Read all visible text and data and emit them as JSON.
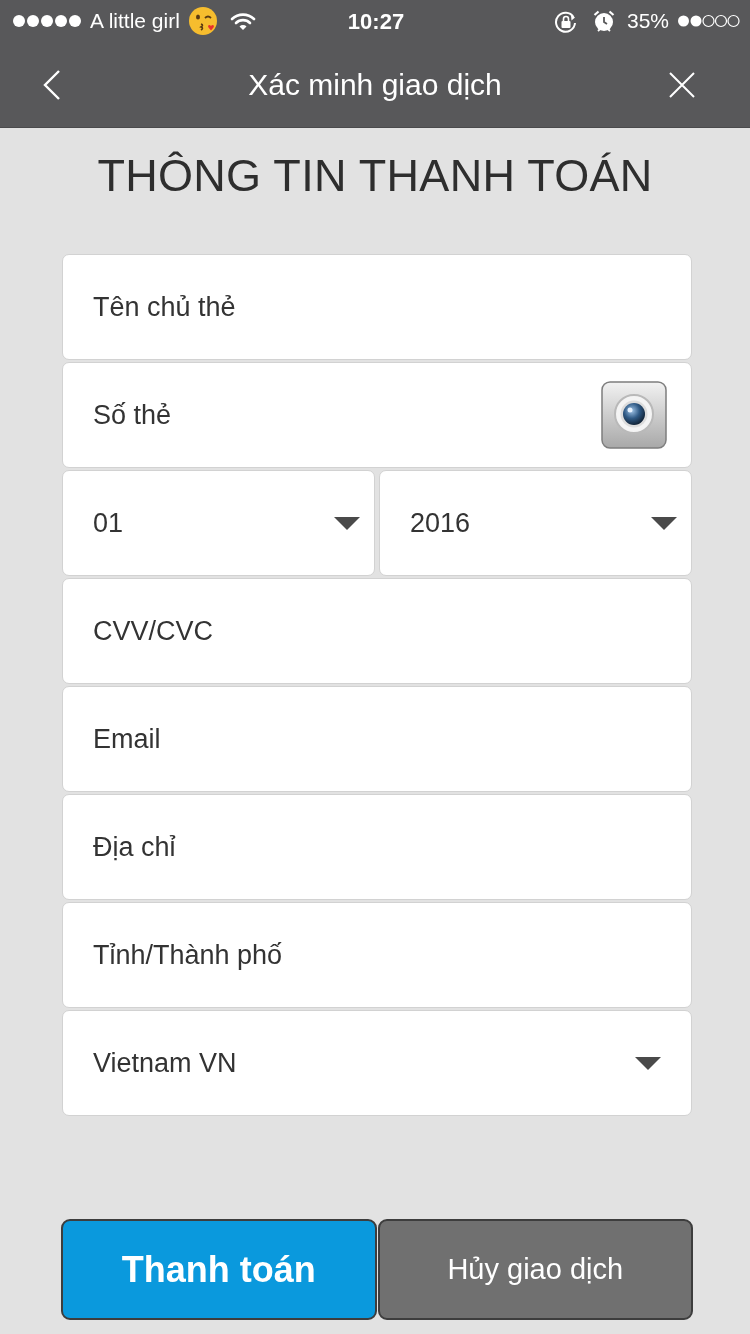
{
  "status_bar": {
    "carrier": "A little girl",
    "time": "10:27",
    "battery": "35%"
  },
  "nav_bar": {
    "title": "Xác minh giao dịch"
  },
  "heading": "THÔNG TIN THANH TOÁN",
  "fields": [
    {
      "kind": "input",
      "placeholder": "Tên chủ thẻ"
    },
    {
      "kind": "input",
      "placeholder": "Số thẻ",
      "camera": true
    },
    {
      "kind": "select_pair",
      "selects": [
        {
          "value": "01"
        },
        {
          "value": "2016"
        }
      ]
    },
    {
      "kind": "input",
      "placeholder": "CVV/CVC"
    },
    {
      "kind": "input",
      "placeholder": "Email"
    },
    {
      "kind": "input",
      "placeholder": "Địa chỉ"
    },
    {
      "kind": "input",
      "placeholder": "Tỉnh/Thành phố"
    },
    {
      "kind": "select",
      "value": "Vietnam VN"
    }
  ],
  "buttons": [
    {
      "kind": "primary",
      "label": "Thanh toán"
    },
    {
      "kind": "secondary",
      "label": "Hủy giao dịch"
    }
  ]
}
